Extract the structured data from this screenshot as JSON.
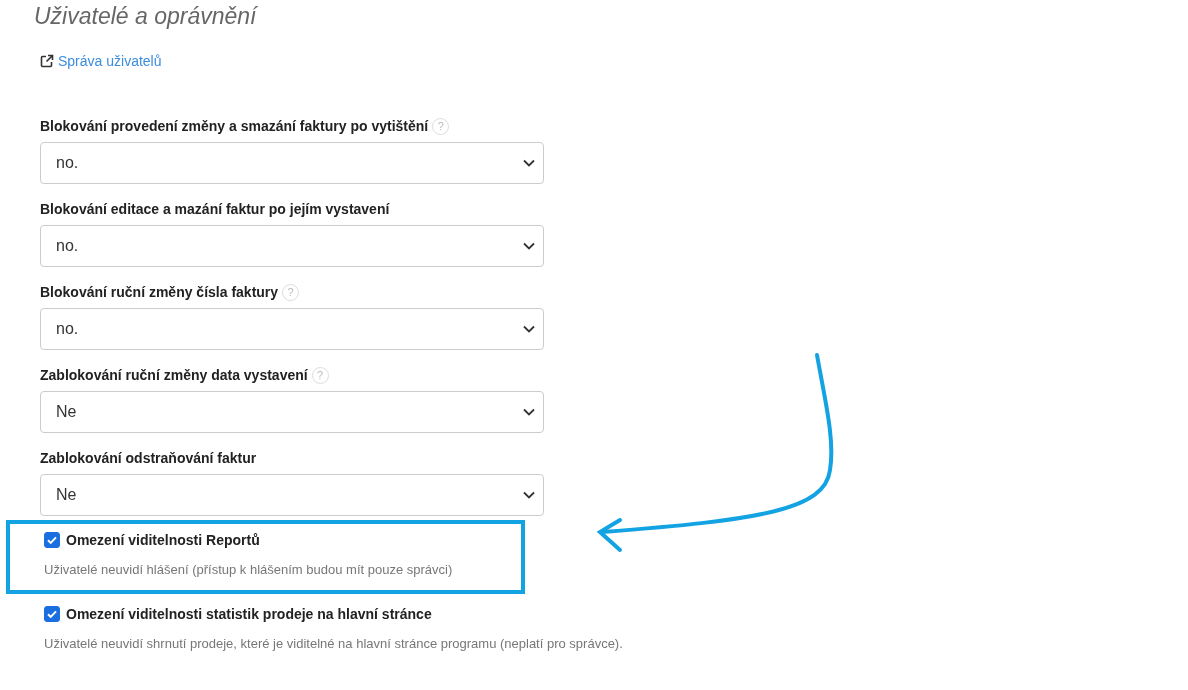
{
  "heading": "Uživatelé a oprávnění",
  "link": {
    "label": "Správa uživatelů"
  },
  "selects": [
    {
      "label": "Blokování provedení změny a smazání faktury po vytištění",
      "help": "?",
      "value": "no."
    },
    {
      "label": "Blokování editace a mazání faktur po jejím vystavení",
      "value": "no."
    },
    {
      "label": "Blokování ruční změny čísla faktury",
      "help": "?",
      "value": "no."
    },
    {
      "label": "Zablokování ruční změny data vystavení",
      "help": "?",
      "value": "Ne"
    },
    {
      "label": "Zablokování odstraňování faktur",
      "value": "Ne"
    }
  ],
  "checkboxes": [
    {
      "label": "Omezení viditelnosti Reportů",
      "checked": true,
      "highlighted": true,
      "description": "Uživatelé neuvidí hlášení (přístup k hlášením budou mít pouze správci)"
    },
    {
      "label": "Omezení viditelnosti statistik prodeje na hlavní stránce",
      "checked": true,
      "highlighted": false,
      "description": "Uživatelé neuvidí shrnutí prodeje, které je viditelné na hlavní stránce programu (neplatí pro správce)."
    }
  ],
  "annotation": {
    "kind": "arrow"
  }
}
